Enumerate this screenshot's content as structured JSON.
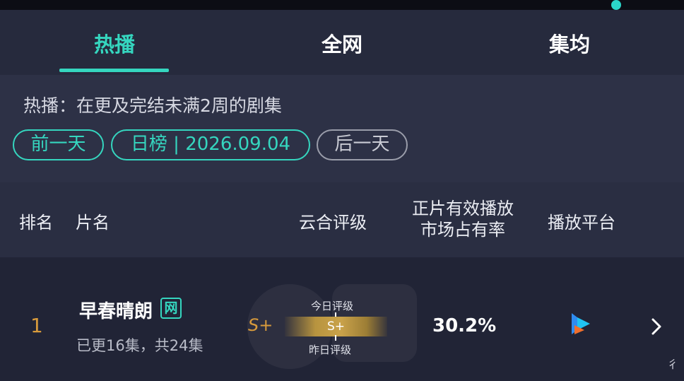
{
  "tabs": [
    {
      "label": "热播",
      "active": true
    },
    {
      "label": "全网",
      "active": false
    },
    {
      "label": "集均",
      "active": false
    }
  ],
  "description": "热播：在更及完结未满2周的剧集",
  "date_nav": {
    "prev": "前一天",
    "current": "日榜 | 2026.09.04",
    "next": "后一天"
  },
  "table": {
    "headers": {
      "rank": "排名",
      "title": "片名",
      "rating": "云合评级",
      "share_line1": "正片有效播放",
      "share_line2": "市场占有率",
      "platform": "播放平台"
    },
    "rows": [
      {
        "rank": "1",
        "title": "早春晴朗",
        "badge": "网",
        "episodes": "已更16集，共24集",
        "grade": "S+",
        "grade_bar": "S+",
        "today_label": "今日评级",
        "yesterday_label": "昨日评级",
        "share": "30.2%",
        "platform_icon": "youku-icon"
      }
    ]
  },
  "edge_glyph": "彳",
  "colors": {
    "accent": "#35d6bf",
    "gold": "#d79a3c",
    "background": "#23273a"
  }
}
